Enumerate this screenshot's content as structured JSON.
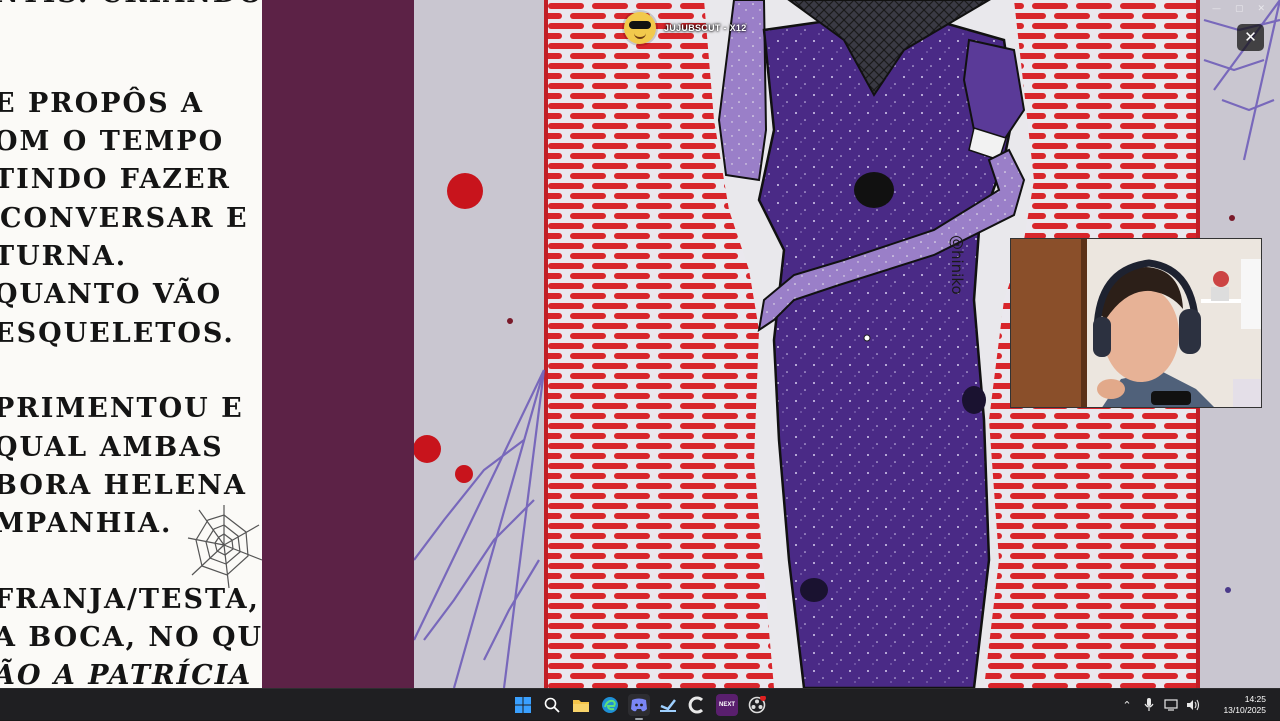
{
  "document": {
    "lines": [
      {
        "text": "NTIS. CRIANDO",
        "italic": false
      },
      {
        "text": "E PROPÔS A",
        "italic": false
      },
      {
        "text": "OM O TEMPO",
        "italic": false
      },
      {
        "text": "TINDO FAZER",
        "italic": false
      },
      {
        "text": "CONVERSAR E",
        "italic": false
      },
      {
        "text": "TURNA.",
        "italic": false
      },
      {
        "text": "QUANTO VÃO",
        "italic": false
      },
      {
        "text": "ESQUELETOS.",
        "italic": false
      },
      {
        "text": "PRIMENTOU E",
        "italic": false
      },
      {
        "text": "QUAL AMBAS",
        "italic": false
      },
      {
        "text": "BORA HELENA",
        "italic": false
      },
      {
        "text": "MPANHIA.",
        "italic": false
      },
      {
        "text": "FRANJA/TESTA,",
        "italic": false
      },
      {
        "text": "A BOCA, NO QUAL",
        "italic": false
      },
      {
        "text": "ÃO A PATRÍCIA",
        "italic": true
      }
    ]
  },
  "stream": {
    "title": "JUJUBSCUT - X12",
    "close_label": "✕",
    "watermark": "@hiniko"
  },
  "colors": {
    "doc_bg": "#fbfaf7",
    "band": "#5c2246",
    "brick": "#d8252b",
    "dress": "#4a2a86",
    "skin": "#9a7fc8",
    "taskbar": "#1f1f22"
  },
  "taskbar": {
    "apps": [
      {
        "name": "start-icon",
        "label": ""
      },
      {
        "name": "search-icon",
        "label": ""
      },
      {
        "name": "file-explorer-icon",
        "label": ""
      },
      {
        "name": "edge-icon",
        "label": ""
      },
      {
        "name": "discord-icon",
        "label": ""
      },
      {
        "name": "steam-icon",
        "label": ""
      },
      {
        "name": "ccleaner-icon",
        "label": ""
      },
      {
        "name": "next-icon",
        "label": "NEXT"
      },
      {
        "name": "obs-icon",
        "label": ""
      }
    ],
    "clock": {
      "time": "14:25",
      "date": "13/10/2025"
    }
  }
}
